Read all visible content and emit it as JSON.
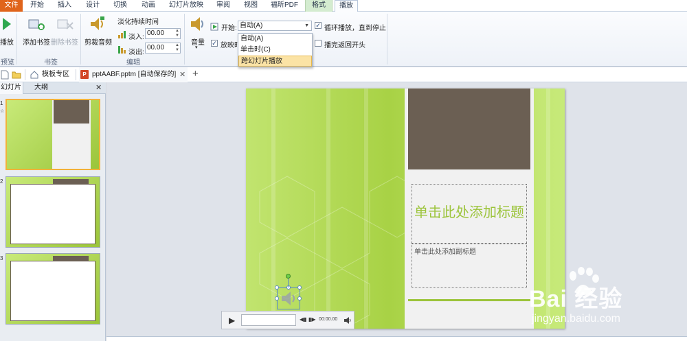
{
  "tabs": [
    "文件",
    "开始",
    "插入",
    "设计",
    "切换",
    "动画",
    "幻灯片放映",
    "审阅",
    "视图",
    "福昕PDF",
    "格式",
    "播放"
  ],
  "ribbon": {
    "preview": {
      "play_label": "播放",
      "group": "预览"
    },
    "bookmarks": {
      "add_label": "添加书签",
      "remove_label": "删除书签",
      "group": "书签"
    },
    "editing": {
      "trim_label": "剪裁音频",
      "fade_title": "淡化持续时间",
      "fade_in_label": "淡入:",
      "fade_in_value": "00.00",
      "fade_out_label": "淡出:",
      "fade_out_value": "00.00",
      "group": "编辑"
    },
    "audio_options": {
      "volume_label": "音量",
      "start_label": "开始:",
      "start_value": "自动(A)",
      "hide_label": "放映时",
      "loop_label": "循环播放，直到停止",
      "rewind_label": "播完返回开头",
      "loop_checked": true,
      "hide_checked": true,
      "rewind_checked": false
    },
    "start_dropdown": [
      "自动(A)",
      "单击时(C)",
      "跨幻灯片播放"
    ]
  },
  "doc_tabs": {
    "template": "模板专区",
    "file": "pptAABF.pptm [自动保存的]"
  },
  "left_panel": {
    "tabs": [
      "幻灯片",
      "大纲"
    ],
    "slide_numbers": [
      "1",
      "2",
      "3"
    ]
  },
  "slide": {
    "title": "单击此处添加标题",
    "subtitle": "单击此处添加副标题"
  },
  "player": {
    "time": "00:00.00"
  },
  "watermark": {
    "brand": "Bai 经验",
    "url": "jingyan.baidu.com"
  },
  "colors": {
    "file_tab": "#e0641b",
    "accent_green": "#9cc43b",
    "photo": "#6b5f53",
    "dropdown_highlight": "#fbe3a5"
  }
}
